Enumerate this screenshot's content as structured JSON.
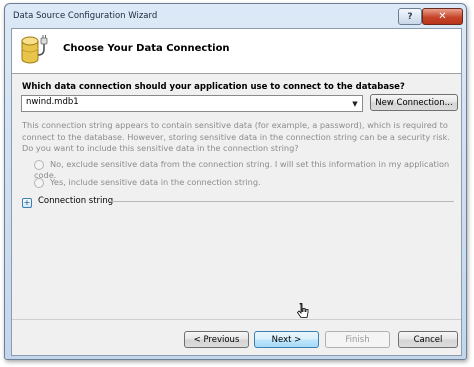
{
  "window": {
    "title": "Data Source Configuration Wizard",
    "help_label": "?",
    "close_label": "✕"
  },
  "header": {
    "title": "Choose Your Data Connection",
    "icon": "database-plug-icon"
  },
  "connection": {
    "question": "Which data connection should your application use to connect to the database?",
    "selected": "nwind.mdb1",
    "new_connection_label": "New Connection..."
  },
  "sensitive": {
    "description": "This connection string appears to contain sensitive data (for example, a password), which is required to connect to the database. However, storing sensitive data in the connection string can be a security risk. Do you want to include this sensitive data in the connection string?",
    "option_no": "No, exclude sensitive data from the connection string. I will set this information in my application code.",
    "option_yes": "Yes, include sensitive data in the connection string."
  },
  "connection_string": {
    "expander": "+",
    "label": "Connection string"
  },
  "footer": {
    "previous_label": "< Previous",
    "next_label": "Next >",
    "finish_label": "Finish",
    "cancel_label": "Cancel"
  }
}
